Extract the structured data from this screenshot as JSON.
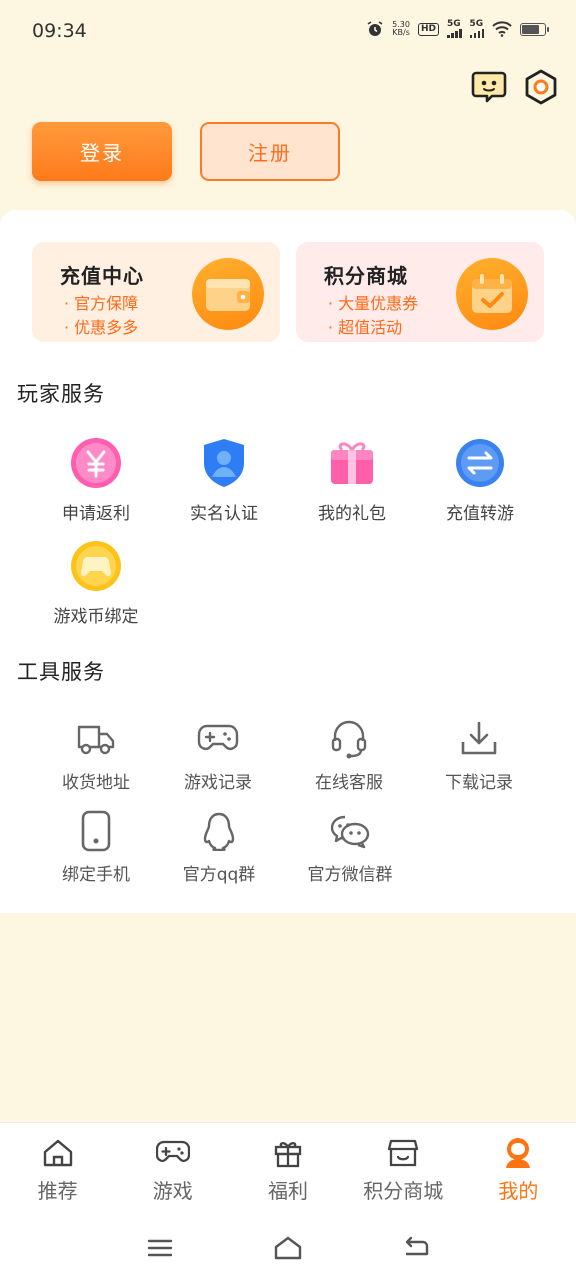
{
  "status": {
    "time": "09:34",
    "speed_value": "5.30",
    "speed_unit": "KB/s",
    "hd": "HD",
    "signal1": "5G",
    "signal2": "5G"
  },
  "auth": {
    "login_label": "登录",
    "register_label": "注册"
  },
  "promos": [
    {
      "title": "充值中心",
      "line1": "· 官方保障",
      "line2": "· 优惠多多"
    },
    {
      "title": "积分商城",
      "line1": "· 大量优惠券",
      "line2": "· 超值活动"
    }
  ],
  "player_services": {
    "title": "玩家服务",
    "items": [
      {
        "label": "申请返利",
        "icon": "rebate-yen-icon"
      },
      {
        "label": "实名认证",
        "icon": "identity-shield-icon"
      },
      {
        "label": "我的礼包",
        "icon": "gift-box-icon"
      },
      {
        "label": "充值转游",
        "icon": "transfer-arrows-icon"
      },
      {
        "label": "游戏币绑定",
        "icon": "gamepad-coin-icon"
      }
    ]
  },
  "tool_services": {
    "title": "工具服务",
    "items": [
      {
        "label": "收货地址",
        "icon": "delivery-truck-icon"
      },
      {
        "label": "游戏记录",
        "icon": "gamepad-icon"
      },
      {
        "label": "在线客服",
        "icon": "headset-icon"
      },
      {
        "label": "下载记录",
        "icon": "download-icon"
      },
      {
        "label": "绑定手机",
        "icon": "phone-icon"
      },
      {
        "label": "官方qq群",
        "icon": "qq-penguin-icon"
      },
      {
        "label": "官方微信群",
        "icon": "wechat-icon"
      }
    ]
  },
  "bottom_nav": {
    "active": "我的",
    "items": [
      {
        "label": "推荐",
        "icon": "home-icon"
      },
      {
        "label": "游戏",
        "icon": "gamepad-icon"
      },
      {
        "label": "福利",
        "icon": "gift-icon"
      },
      {
        "label": "积分商城",
        "icon": "store-icon"
      },
      {
        "label": "我的",
        "icon": "user-icon"
      }
    ]
  },
  "colors": {
    "accent": "#ff7a1a",
    "page_bg": "#fdf6e0"
  }
}
